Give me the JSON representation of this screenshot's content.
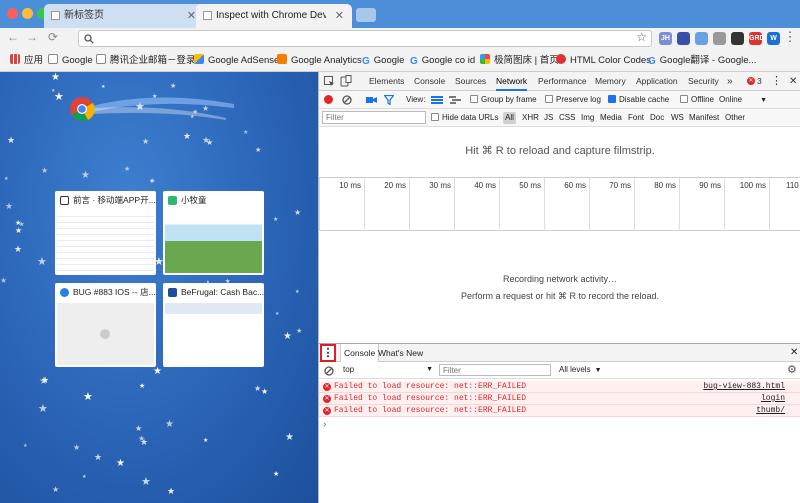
{
  "tabs": [
    {
      "label": "新标签页",
      "active": false
    },
    {
      "label": "Inspect with Chrome Develope",
      "active": true
    }
  ],
  "omnibox": {
    "value": ""
  },
  "bookmarks": [
    "应用",
    "Google",
    "腾讯企业邮箱－登录...",
    "Google AdSense",
    "Google Analytics",
    "Google",
    "Google co id",
    "极简图床 | 首页",
    "HTML Color Codes",
    "Google翻译 - Google..."
  ],
  "ext_labels": [
    "JH",
    "GRD",
    "W"
  ],
  "new_tab": {
    "tiles": [
      {
        "title": "前言 · 移动端APP开..."
      },
      {
        "title": "小牧童"
      },
      {
        "title": "BUG #883 IOS -- 店..."
      },
      {
        "title": "BeFrugal: Cash Bac..."
      }
    ]
  },
  "devtools": {
    "tabs": [
      "Elements",
      "Console",
      "Sources",
      "Network",
      "Performance",
      "Memory",
      "Application",
      "Security"
    ],
    "more": "»",
    "error_count": "3",
    "network": {
      "view_label": "View:",
      "group_by_frame": "Group by frame",
      "preserve_log": "Preserve log",
      "disable_cache": "Disable cache",
      "offline": "Offline",
      "throttle": "Online",
      "filter_placeholder": "Filter",
      "hide_data_urls": "Hide data URLs",
      "types": [
        "All",
        "XHR",
        "JS",
        "CSS",
        "Img",
        "Media",
        "Font",
        "Doc",
        "WS",
        "Manifest",
        "Other"
      ],
      "reload_hint": "Hit ⌘ R to reload and capture filmstrip.",
      "ticks": [
        "10 ms",
        "20 ms",
        "30 ms",
        "40 ms",
        "50 ms",
        "60 ms",
        "70 ms",
        "80 ms",
        "90 ms",
        "100 ms",
        "110 m"
      ],
      "recording": "Recording network activity…",
      "perform_hint": "Perform a request or hit ⌘ R to record the reload."
    },
    "drawer": {
      "tabs": [
        "Console",
        "What's New"
      ],
      "context": "top",
      "filter_placeholder": "Filter",
      "levels": "All levels",
      "messages": [
        {
          "text": "Failed to load resource: net::ERR_FAILED",
          "source": "bug-view-883.html"
        },
        {
          "text": "Failed to load resource: net::ERR_FAILED",
          "source": "login"
        },
        {
          "text": "Failed to load resource: net::ERR_FAILED",
          "source": "thumb/"
        }
      ],
      "prompt": "›"
    }
  },
  "colors": {
    "accent": "#1a73e8",
    "error": "#e0262b",
    "highlight": "#d9202a"
  }
}
